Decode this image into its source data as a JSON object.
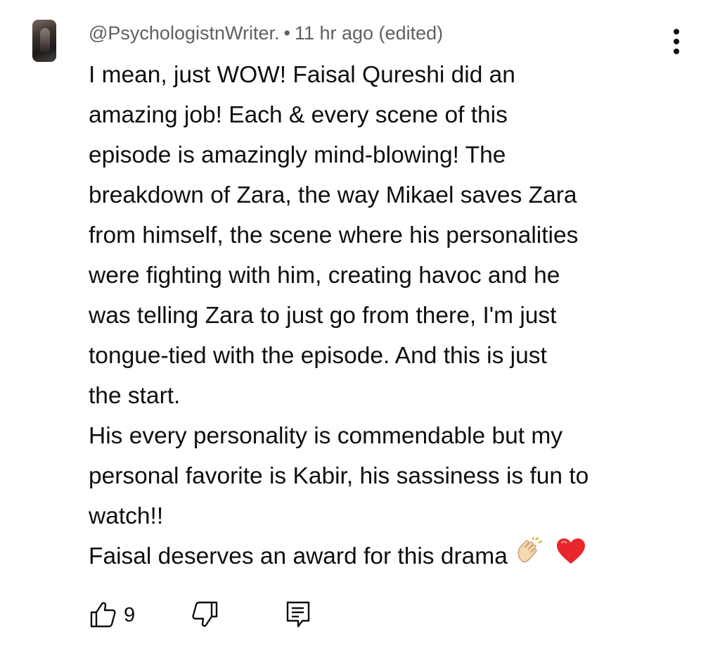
{
  "comment": {
    "author": "@PsychologistnWriter.",
    "separator": "•",
    "timestamp": "11 hr ago (edited)",
    "lines": [
      "I mean, just WOW! Faisal Qureshi did an",
      "amazing job! Each & every scene of this",
      "episode is amazingly mind-blowing! The",
      "breakdown of Zara, the way Mikael saves Zara",
      "from himself, the scene where his personalities",
      "were fighting with him, creating havoc and he",
      "was telling Zara to just go from there, I'm just",
      "tongue-tied with the episode. And this is just",
      "the start.",
      "His every personality is commendable but my",
      "personal favorite is Kabir, his sassiness is fun to",
      "watch!!",
      "Faisal deserves an award for this drama"
    ],
    "emojis": [
      "clapping-hands-emoji",
      "red-heart-emoji"
    ],
    "like_count": "9",
    "icons": {
      "menu": "more-vert-icon",
      "like": "thumb-up-icon",
      "dislike": "thumb-down-icon",
      "reply": "reply-comment-icon"
    },
    "colors": {
      "text": "#0f0f0f",
      "meta": "#606060",
      "heart": "#e8262c",
      "clap": "#f5d9b0"
    }
  }
}
